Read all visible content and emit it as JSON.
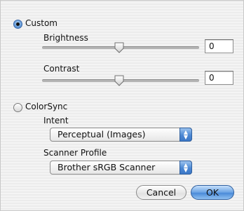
{
  "custom": {
    "label": "Custom",
    "selected": true,
    "brightness": {
      "label": "Brightness",
      "value": "0"
    },
    "contrast": {
      "label": "Contrast",
      "value": "0"
    }
  },
  "colorsync": {
    "label": "ColorSync",
    "selected": false,
    "intent": {
      "label": "Intent",
      "selected": "Perceptual (Images)"
    },
    "scanner_profile": {
      "label": "Scanner Profile",
      "selected": "Brother sRGB Scanner"
    }
  },
  "buttons": {
    "cancel": "Cancel",
    "ok": "OK"
  },
  "colors": {
    "accent": "#4a8ad8"
  }
}
